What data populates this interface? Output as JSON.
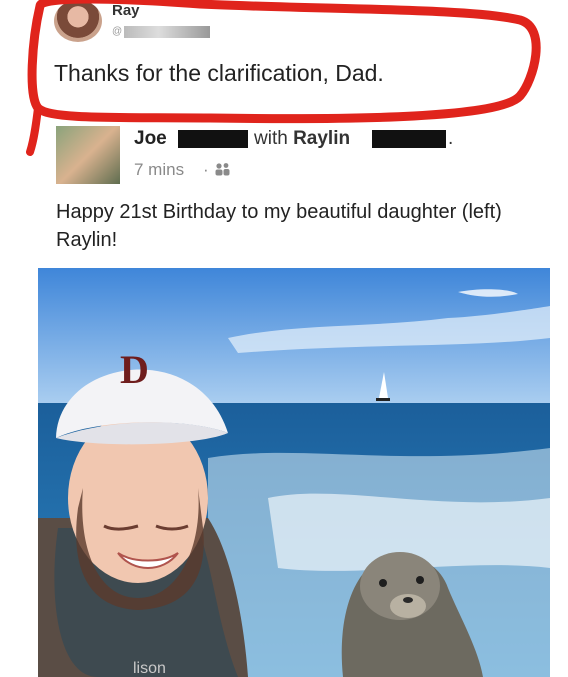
{
  "comment": {
    "author": "Ray",
    "handle_prefix": "@",
    "text": "Thanks for the clarification, Dad."
  },
  "post": {
    "author": "Joe",
    "with_text": "with",
    "tagged": "Raylin",
    "trailing": ".",
    "time": "7 mins",
    "separator": "·",
    "audience_icon": "friends-icon",
    "text": "Happy 21st Birthday to my beautiful daughter (left) Raylin!"
  },
  "photo": {
    "caption_hint": "woman in cap and sea lion on boat selfie",
    "cap_logo": "D",
    "shirt_text": "lison"
  },
  "colors": {
    "highlight_red": "#e0241c",
    "sky": "#5b9be0",
    "sea": "#1f6fae"
  }
}
